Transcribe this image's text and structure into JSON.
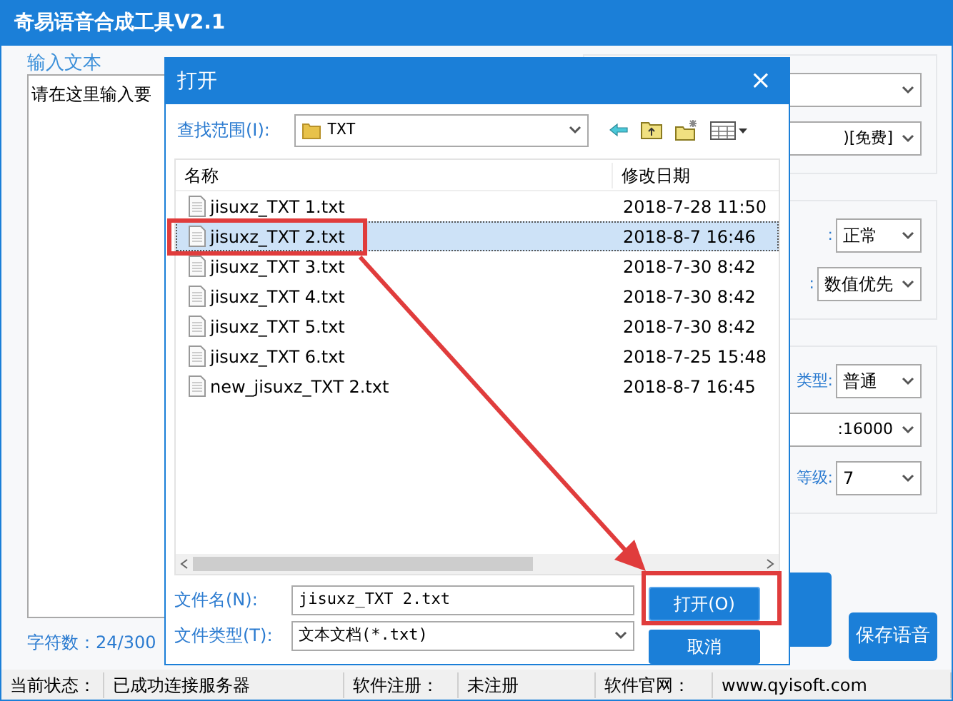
{
  "window": {
    "title": "奇易语音合成工具V2.1"
  },
  "input_panel": {
    "label": "输入文本",
    "text": "请在这里输入要",
    "char_count": "字符数：24/300"
  },
  "settings_groups": [
    {
      "items": [
        {
          "kind": "select"
        },
        {
          "kind": "select",
          "value": ")[免费]"
        }
      ]
    },
    {
      "items": [
        {
          "kind": "select",
          "label": ":",
          "value": "正常"
        },
        {
          "kind": "select",
          "label": ":",
          "value": "数值优先"
        }
      ]
    },
    {
      "items": [
        {
          "kind": "select",
          "label": "类型:",
          "value": "普通"
        },
        {
          "kind": "select",
          "value": ":16000"
        },
        {
          "kind": "select",
          "label": "等级:",
          "value": "7"
        }
      ]
    }
  ],
  "save_button": "保存语音",
  "status_bar": [
    {
      "text": "当前状态："
    },
    {
      "text": "已成功连接服务器"
    },
    {
      "text": "软件注册："
    },
    {
      "text": "未注册"
    },
    {
      "text": "软件官网："
    },
    {
      "text": "www.qyisoft.com"
    }
  ],
  "dialog": {
    "title": "打开",
    "close": "×",
    "look_in_label": "查找范围(I):",
    "look_in_value": "TXT",
    "columns": [
      "名称",
      "修改日期"
    ],
    "files": [
      {
        "name": "jisuxz_TXT 1.txt",
        "modified": "2018-7-28 11:50",
        "selected": false
      },
      {
        "name": "jisuxz_TXT 2.txt",
        "modified": "2018-8-7 16:46",
        "selected": true
      },
      {
        "name": "jisuxz_TXT 3.txt",
        "modified": "2018-7-30 8:42",
        "selected": false
      },
      {
        "name": "jisuxz_TXT 4.txt",
        "modified": "2018-7-30 8:42",
        "selected": false
      },
      {
        "name": "jisuxz_TXT 5.txt",
        "modified": "2018-7-30 8:42",
        "selected": false
      },
      {
        "name": "jisuxz_TXT 6.txt",
        "modified": "2018-7-25 15:48",
        "selected": false
      },
      {
        "name": "new_jisuxz_TXT 2.txt",
        "modified": "2018-8-7 16:45",
        "selected": false
      }
    ],
    "file_name_label": "文件名(N):",
    "file_name_value": "jisuxz_TXT 2.txt",
    "file_type_label": "文件类型(T):",
    "file_type_value": "文本文档(*.txt)",
    "open_button": "打开(O)",
    "cancel_button": "取消"
  }
}
